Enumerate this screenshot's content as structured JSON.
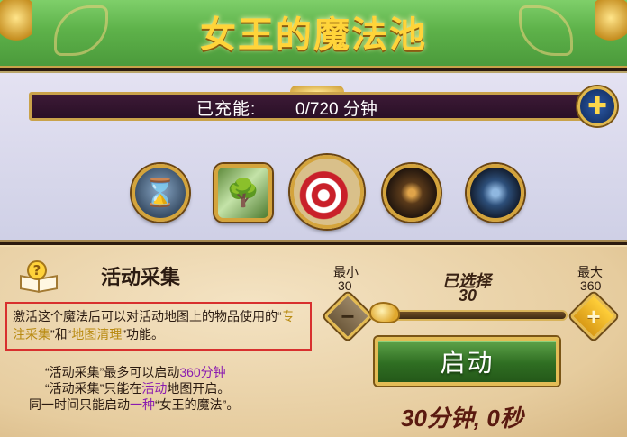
{
  "header": {
    "title": "女王的魔法池"
  },
  "energy": {
    "label": "已充能:",
    "value": "0/720 分钟"
  },
  "orbs": [
    {
      "icon": "hourglass-icon"
    },
    {
      "icon": "forest-painting-icon"
    },
    {
      "icon": "target-mummy-icon"
    },
    {
      "icon": "golden-swirl-icon"
    },
    {
      "icon": "blue-swirl-icon"
    }
  ],
  "skill": {
    "name": "活动采集",
    "desc_prefix": "激活这个魔法后可以对活动地图上的物品使用的",
    "desc_q1_open": "“",
    "desc_hl1": "专注采集",
    "desc_q1_close": "”",
    "desc_mid": "和",
    "desc_q2_open": "“",
    "desc_hl2": "地图清理",
    "desc_q2_close": "”",
    "desc_suffix": "功能。"
  },
  "info": {
    "line1_a": "“活动采集”最多可以启动",
    "line1_hl": "360分钟",
    "line2_a": "“活动采集”只能在",
    "line2_hl": "活动",
    "line2_b": "地图开启。",
    "line3_a": "同一时间只能启动",
    "line3_hl": "一种",
    "line3_b": "“女王的魔法”。"
  },
  "slider": {
    "min_label": "最小",
    "min_value": "30",
    "max_label": "最大",
    "max_value": "360",
    "selected_label": "已选择",
    "selected_value": "30",
    "position_fraction": 0.0,
    "minus": "−",
    "plus": "+"
  },
  "start_button": "启动",
  "duration": "30分钟, 0秒",
  "colors": {
    "header_green": "#5eb24a",
    "title_gold": "#ffd43a",
    "highlight_purple": "#8a1bb0",
    "highlight_gold": "#b88a10",
    "start_green": "#2f6e22"
  }
}
